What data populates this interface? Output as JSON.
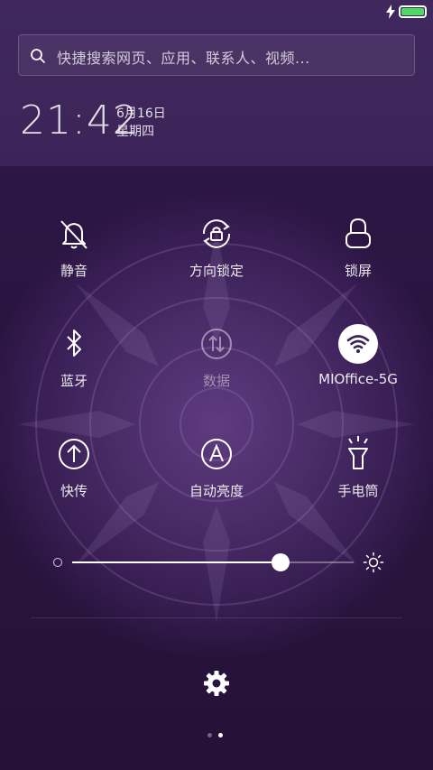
{
  "status_bar": {
    "battery_level": 1.0,
    "charging": true,
    "battery_color": "#4cd964"
  },
  "search": {
    "placeholder": "快捷搜索网页、应用、联系人、视频..."
  },
  "clock": {
    "time": "21:42",
    "date": "6月16日",
    "weekday": "星期四"
  },
  "toggles": [
    {
      "label": "静音",
      "icon": "bell-off-icon",
      "active": false
    },
    {
      "label": "方向锁定",
      "icon": "rotation-lock-icon",
      "active": false
    },
    {
      "label": "锁屏",
      "icon": "lock-icon",
      "active": false
    },
    {
      "label": "蓝牙",
      "icon": "bluetooth-icon",
      "active": false
    },
    {
      "label": "数据",
      "icon": "mobile-data-icon",
      "active": false,
      "disabled": true
    },
    {
      "label": "MIOffice-5G",
      "icon": "wifi-icon",
      "active": true
    },
    {
      "label": "快传",
      "icon": "quick-transfer-icon",
      "active": false
    },
    {
      "label": "自动亮度",
      "icon": "auto-brightness-icon",
      "active": false
    },
    {
      "label": "手电筒",
      "icon": "flashlight-icon",
      "active": false
    }
  ],
  "brightness": {
    "level": 0.74
  },
  "pager": {
    "page_count": 2,
    "current_page": 2
  },
  "colors": {
    "accent": "#ffffff",
    "background": "#2a1540",
    "wifi_active_bg": "#ffffff"
  }
}
